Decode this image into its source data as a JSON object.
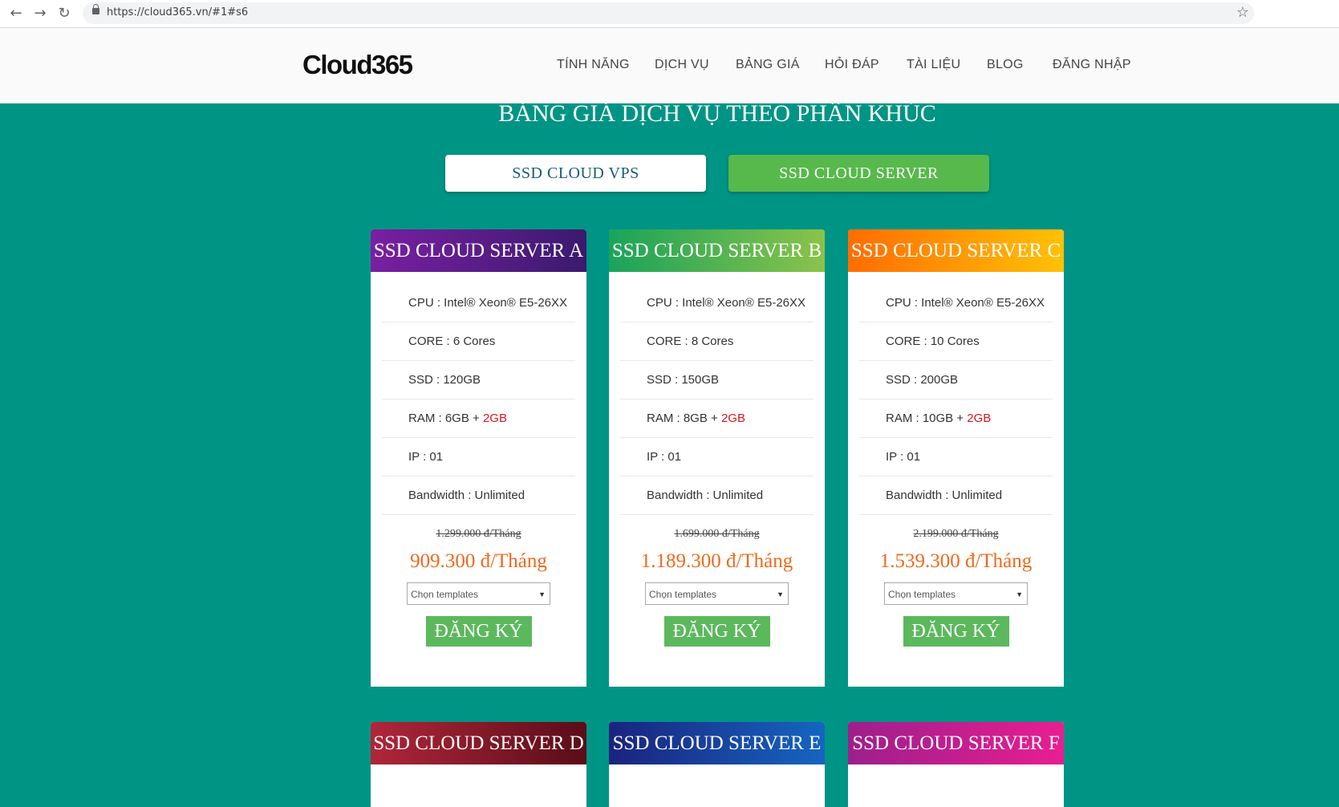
{
  "browser": {
    "url": "https://cloud365.vn/#1#s6",
    "icons": [
      "back-arrow-icon",
      "forward-arrow-icon",
      "reload-icon",
      "lock-icon",
      "star-icon"
    ]
  },
  "header": {
    "logo": "Cloud365",
    "menu": [
      "TÍNH NĂNG",
      "DỊCH VỤ",
      "BẢNG GIÁ",
      "HỎI ĐÁP",
      "TÀI LIỆU",
      "BLOG",
      "ĐĂNG NHẬP"
    ]
  },
  "section": {
    "title": "BẢNG GIÁ DỊCH VỤ THEO PHÂN KHÚC",
    "tabs": [
      "SSD CLOUD VPS",
      "SSD CLOUD SERVER"
    ]
  },
  "plans": [
    {
      "name": "SSD CLOUD SERVER A",
      "cpu": "CPU : Intel® Xeon® E5-26XX",
      "core": "CORE : 6 Cores",
      "ssd": "SSD : 120GB",
      "ram": "RAM : 6GB + ",
      "ram_extra": "2GB",
      "ip": "IP : 01",
      "bandwidth": "Bandwidth : Unlimited",
      "old_price": "1.299.000 đ/Tháng",
      "price": "909.300 đ/Tháng",
      "select_placeholder": "Chọn templates",
      "button": "ĐĂNG KÝ"
    },
    {
      "name": "SSD CLOUD SERVER B",
      "cpu": "CPU : Intel® Xeon® E5-26XX",
      "core": "CORE : 8 Cores",
      "ssd": "SSD : 150GB",
      "ram": "RAM : 8GB + ",
      "ram_extra": "2GB",
      "ip": "IP : 01",
      "bandwidth": "Bandwidth : Unlimited",
      "old_price": "1.699.000 đ/Tháng",
      "price": "1.189.300 đ/Tháng",
      "select_placeholder": "Chọn templates",
      "button": "ĐĂNG KÝ"
    },
    {
      "name": "SSD CLOUD SERVER C",
      "cpu": "CPU : Intel® Xeon® E5-26XX",
      "core": "CORE : 10 Cores",
      "ssd": "SSD : 200GB",
      "ram": "RAM : 10GB + ",
      "ram_extra": "2GB",
      "ip": "IP : 01",
      "bandwidth": "Bandwidth : Unlimited",
      "old_price": "2.199.000 đ/Tháng",
      "price": "1.539.300 đ/Tháng",
      "select_placeholder": "Chọn templates",
      "button": "ĐĂNG KÝ"
    }
  ],
  "plans_row2": [
    "SSD CLOUD SERVER D",
    "SSD CLOUD SERVER E",
    "SSD CLOUD SERVER F"
  ],
  "colors": {
    "background": "#009485",
    "tab_active": "#57b94c",
    "price": "#f06a1c",
    "ram_extra": "#e0161d",
    "button": "#5cb85c"
  }
}
